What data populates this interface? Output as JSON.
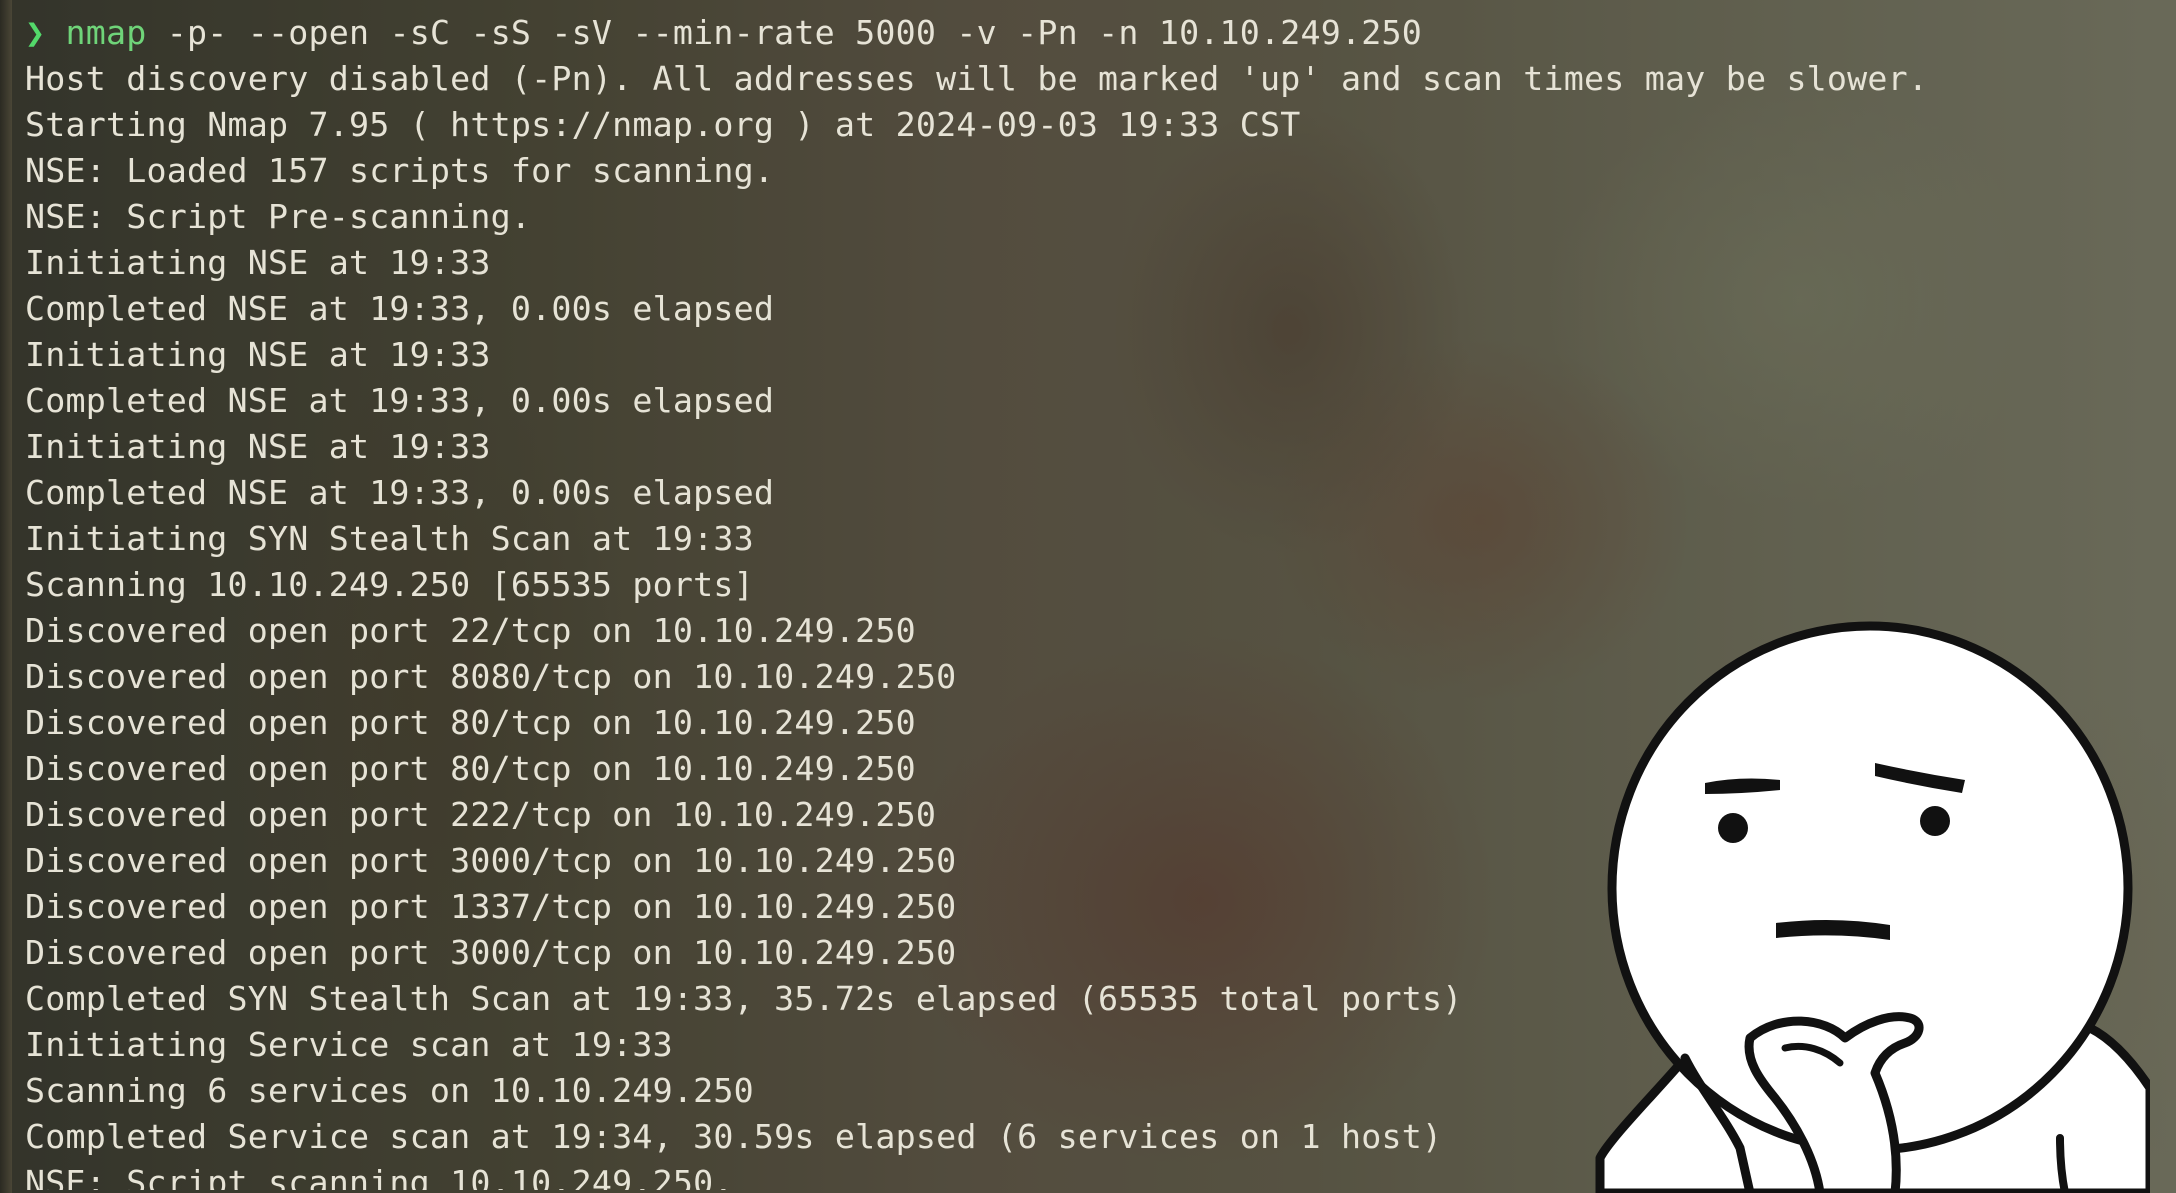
{
  "terminal": {
    "prompt_symbol": "❯",
    "command": {
      "program": "nmap",
      "args": " -p- --open -sC -sS -sV --min-rate 5000 -v -Pn -n 10.10.249.250"
    },
    "output_lines": [
      "Host discovery disabled (-Pn). All addresses will be marked 'up' and scan times may be slower.",
      "Starting Nmap 7.95 ( https://nmap.org ) at 2024-09-03 19:33 CST",
      "NSE: Loaded 157 scripts for scanning.",
      "NSE: Script Pre-scanning.",
      "Initiating NSE at 19:33",
      "Completed NSE at 19:33, 0.00s elapsed",
      "Initiating NSE at 19:33",
      "Completed NSE at 19:33, 0.00s elapsed",
      "Initiating NSE at 19:33",
      "Completed NSE at 19:33, 0.00s elapsed",
      "Initiating SYN Stealth Scan at 19:33",
      "Scanning 10.10.249.250 [65535 ports]",
      "Discovered open port 22/tcp on 10.10.249.250",
      "Discovered open port 8080/tcp on 10.10.249.250",
      "Discovered open port 80/tcp on 10.10.249.250",
      "Discovered open port 80/tcp on 10.10.249.250",
      "Discovered open port 222/tcp on 10.10.249.250",
      "Discovered open port 3000/tcp on 10.10.249.250",
      "Discovered open port 1337/tcp on 10.10.249.250",
      "Discovered open port 3000/tcp on 10.10.249.250",
      "Completed SYN Stealth Scan at 19:33, 35.72s elapsed (65535 total ports)",
      "Initiating Service scan at 19:33",
      "Scanning 6 services on 10.10.249.250",
      "Completed Service scan at 19:34, 30.59s elapsed (6 services on 1 host)",
      "NSE: Script scanning 10.10.249.250."
    ]
  },
  "overlay": {
    "sticker_icon": "thinking-face-meme-icon"
  },
  "colors": {
    "prompt": "#53d86a",
    "command": "#6fd479",
    "text": "#e6e3d6"
  }
}
